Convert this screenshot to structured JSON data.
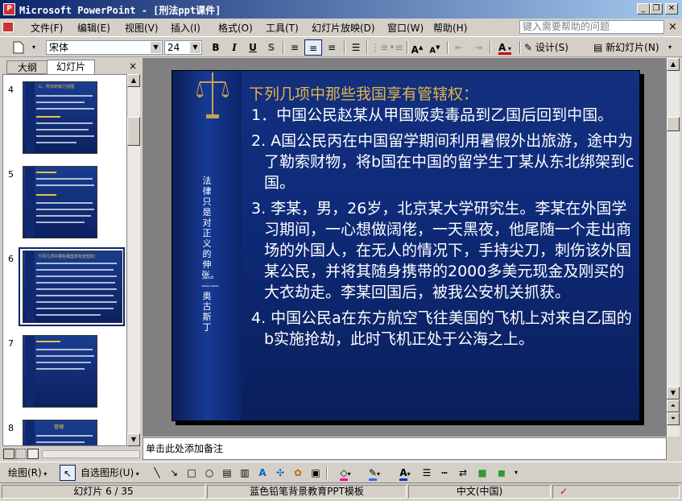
{
  "window": {
    "title": "Microsoft PowerPoint - [刑法ppt课件]",
    "minimize": "_",
    "restore": "❐",
    "close": "✕"
  },
  "menubar": {
    "items": [
      "文件(F)",
      "编辑(E)",
      "视图(V)",
      "插入(I)",
      "格式(O)",
      "工具(T)",
      "幻灯片放映(D)",
      "窗口(W)",
      "帮助(H)"
    ],
    "help_placeholder": "键入需要帮助的问题",
    "close_doc": "×"
  },
  "toolbar": {
    "font": "宋体",
    "size": "24",
    "bold": "B",
    "italic": "I",
    "underline": "U",
    "shadow": "S",
    "font_color": "A",
    "design": "设计(S)",
    "new_slide": "新幻灯片(N)"
  },
  "panes": {
    "tab_outline": "大纲",
    "tab_slides": "幻灯片",
    "close": "×"
  },
  "thumbnails": [
    {
      "number": "4",
      "heading": "三、刑法的效力范围"
    },
    {
      "number": "5",
      "heading": ""
    },
    {
      "number": "6",
      "heading": "下列几项中那些我国享有管辖权："
    },
    {
      "number": "7",
      "heading": ""
    },
    {
      "number": "8",
      "heading": "管辖"
    }
  ],
  "slide": {
    "title": "下列几项中那些我国享有管辖权：",
    "side_text": "法律只是对正义的伸张。——奥古斯丁",
    "items": [
      "1．中国公民赵某从甲国贩卖毒品到乙国后回到中国。",
      "2. A国公民丙在中国留学期间利用暑假外出旅游，途中为了勒索财物，将b国在中国的留学生丁某从东北绑架到c国。",
      "3. 李某，男，26岁，北京某大学研究生。李某在外国学习期间，一心想做阔佬，一天黑夜，他尾随一个走出商场的外国人，在无人的情况下，手持尖刀，刺伤该外国某公民，并将其随身携带的2000多美元现金及刚买的大衣劫走。李某回国后，被我公安机关抓获。",
      "4. 中国公民a在东方航空飞往美国的飞机上对来自乙国的b实施抢劫，此时飞机正处于公海之上。"
    ]
  },
  "notes": {
    "placeholder": "单击此处添加备注"
  },
  "drawbar": {
    "draw": "绘图(R)",
    "autoshapes": "自选图形(U)"
  },
  "status": {
    "slide": "幻灯片 6 / 35",
    "template": "蓝色铅笔背景教育PPT模板",
    "language": "中文(中国)"
  },
  "colors": {
    "accent": "#0a246a",
    "slide_title": "#e1b54a",
    "slide_bg": "#0e2a78"
  }
}
